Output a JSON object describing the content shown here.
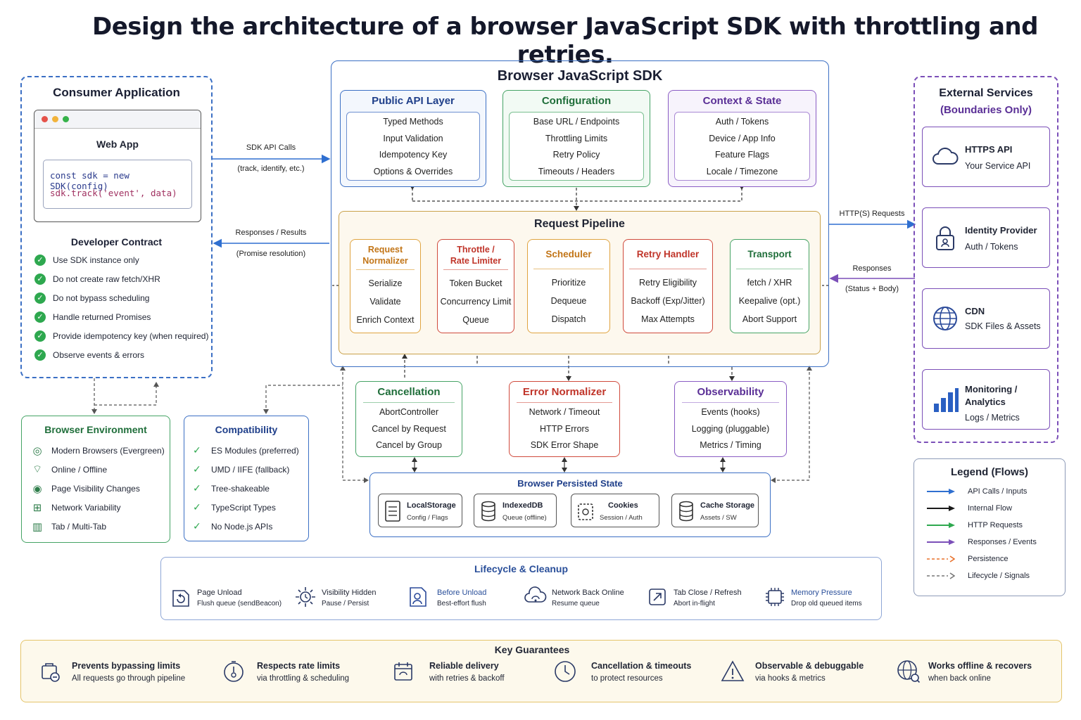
{
  "title": "Design the architecture of a browser JavaScript SDK with throttling and retries.",
  "consumer": {
    "title": "Consumer Application",
    "webapp_title": "Web App",
    "code_line1": "const sdk = new SDK(config)",
    "code_line2": "sdk.track('event', data)",
    "contract_title": "Developer Contract",
    "contract_items": [
      "Use SDK instance only",
      "Do not create raw fetch/XHR",
      "Do not bypass scheduling",
      "Handle returned Promises",
      "Provide idempotency key (when required)",
      "Observe events & errors"
    ]
  },
  "flows": {
    "sdk_api_calls": "SDK API Calls",
    "sdk_api_calls_sub": "(track, identify, etc.)",
    "responses_results": "Responses / Results",
    "promise_resolution": "(Promise resolution)",
    "https_requests": "HTTP(S) Requests",
    "responses": "Responses",
    "status_body": "(Status + Body)"
  },
  "sdk": {
    "title": "Browser JavaScript SDK",
    "public_api": {
      "title": "Public API Layer",
      "items": [
        "Typed Methods",
        "Input Validation",
        "Idempotency Key",
        "Options & Overrides"
      ]
    },
    "configuration": {
      "title": "Configuration",
      "items": [
        "Base URL / Endpoints",
        "Throttling Limits",
        "Retry Policy",
        "Timeouts / Headers"
      ]
    },
    "context": {
      "title": "Context & State",
      "items": [
        "Auth / Tokens",
        "Device / App Info",
        "Feature Flags",
        "Locale / Timezone"
      ]
    },
    "pipeline": {
      "title": "Request Pipeline",
      "stages": [
        {
          "title_1": "Request",
          "title_2": "Normalizer",
          "items": [
            "Serialize",
            "Validate",
            "Enrich Context"
          ]
        },
        {
          "title_1": "Throttle /",
          "title_2": "Rate Limiter",
          "items": [
            "Token Bucket",
            "Concurrency Limit",
            "Queue"
          ]
        },
        {
          "title_1": "Scheduler",
          "title_2": "",
          "items": [
            "Prioritize",
            "Dequeue",
            "Dispatch"
          ]
        },
        {
          "title_1": "Retry Handler",
          "title_2": "",
          "items": [
            "Retry Eligibility",
            "Backoff (Exp/Jitter)",
            "Max Attempts"
          ]
        },
        {
          "title_1": "Transport",
          "title_2": "",
          "items": [
            "fetch / XHR",
            "Keepalive (opt.)",
            "Abort Support"
          ]
        }
      ]
    }
  },
  "cancellation": {
    "title": "Cancellation",
    "items": [
      "AbortController",
      "Cancel by Request",
      "Cancel by Group"
    ]
  },
  "error_normalizer": {
    "title": "Error Normalizer",
    "items": [
      "Network / Timeout",
      "HTTP Errors",
      "SDK Error Shape"
    ]
  },
  "observability": {
    "title": "Observability",
    "items": [
      "Events (hooks)",
      "Logging (pluggable)",
      "Metrics / Timing"
    ]
  },
  "persisted": {
    "title": "Browser Persisted State",
    "stores": [
      {
        "name": "LocalStorage",
        "sub": "Config / Flags"
      },
      {
        "name": "IndexedDB",
        "sub": "Queue (offline)"
      },
      {
        "name": "Cookies",
        "sub": "Session / Auth"
      },
      {
        "name": "Cache Storage",
        "sub": "Assets / SW"
      }
    ]
  },
  "browser_env": {
    "title": "Browser Environment",
    "items": [
      "Modern Browsers (Evergreen)",
      "Online / Offline",
      "Page Visibility Changes",
      "Network Variability",
      "Tab / Multi-Tab"
    ]
  },
  "compatibility": {
    "title": "Compatibility",
    "items": [
      "ES Modules (preferred)",
      "UMD / IIFE (fallback)",
      "Tree-shakeable",
      "TypeScript Types",
      "No Node.js APIs"
    ]
  },
  "external": {
    "title": "External Services",
    "subtitle": "(Boundaries Only)",
    "services": [
      {
        "name": "HTTPS API",
        "sub": "Your Service API"
      },
      {
        "name": "Identity Provider",
        "sub": "Auth / Tokens"
      },
      {
        "name": "CDN",
        "sub": "SDK Files & Assets"
      },
      {
        "name": "Monitoring /",
        "name_2": "Analytics",
        "sub": "Logs / Metrics"
      }
    ]
  },
  "legend": {
    "title": "Legend (Flows)",
    "items": [
      "API Calls / Inputs",
      "Internal Flow",
      "HTTP Requests",
      "Responses / Events",
      "Persistence",
      "Lifecycle / Signals"
    ],
    "colors": [
      "#2f6fd0",
      "#1a1a1a",
      "#2ea84f",
      "#7b4fb8",
      "#e8702a",
      "#777777"
    ]
  },
  "lifecycle": {
    "title": "Lifecycle & Cleanup",
    "items": [
      {
        "name": "Page Unload",
        "sub": "Flush queue (sendBeacon)"
      },
      {
        "name": "Visibility Hidden",
        "sub": "Pause / Persist"
      },
      {
        "name": "Before Unload",
        "sub": "Best-effort flush"
      },
      {
        "name": "Network Back Online",
        "sub": "Resume queue"
      },
      {
        "name": "Tab Close / Refresh",
        "sub": "Abort in-flight"
      },
      {
        "name": "Memory Pressure",
        "sub": "Drop old queued items"
      }
    ]
  },
  "guarantees": {
    "title": "Key Guarantees",
    "items": [
      {
        "name": "Prevents bypassing limits",
        "sub": "All requests go through pipeline"
      },
      {
        "name": "Respects rate limits",
        "sub": "via throttling & scheduling"
      },
      {
        "name": "Reliable delivery",
        "sub": "with retries & backoff"
      },
      {
        "name": "Cancellation & timeouts",
        "sub": "to protect resources"
      },
      {
        "name": "Observable & debuggable",
        "sub": "via hooks & metrics"
      },
      {
        "name": "Works offline & recovers",
        "sub": "when back online"
      }
    ]
  }
}
